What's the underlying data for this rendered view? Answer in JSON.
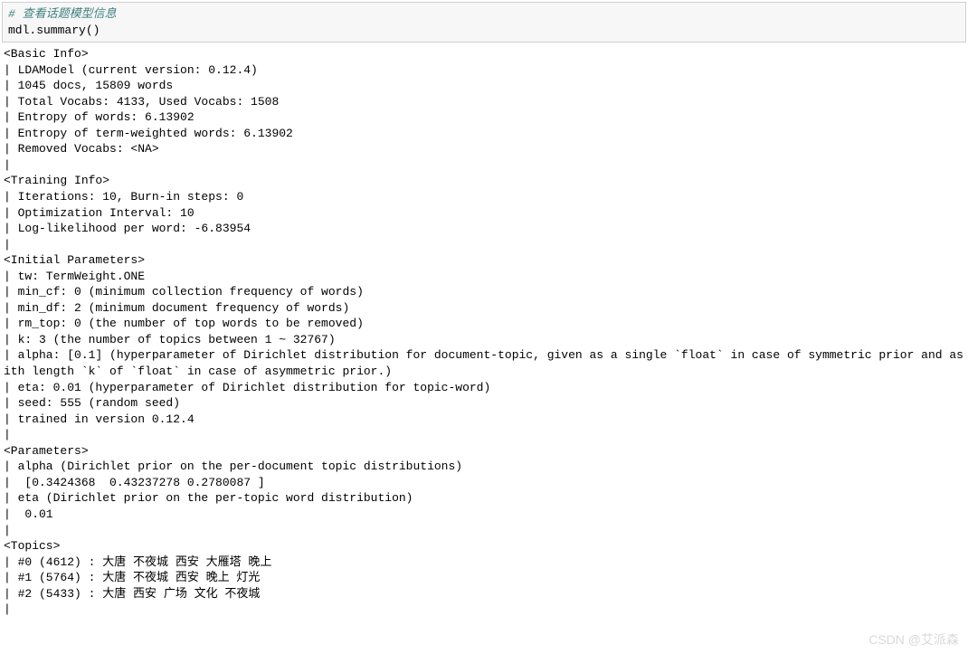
{
  "cell": {
    "comment": "# 查看话题模型信息",
    "code": "mdl.summary()"
  },
  "output_lines": [
    "<Basic Info>",
    "| LDAModel (current version: 0.12.4)",
    "| 1045 docs, 15809 words",
    "| Total Vocabs: 4133, Used Vocabs: 1508",
    "| Entropy of words: 6.13902",
    "| Entropy of term-weighted words: 6.13902",
    "| Removed Vocabs: <NA>",
    "|",
    "<Training Info>",
    "| Iterations: 10, Burn-in steps: 0",
    "| Optimization Interval: 10",
    "| Log-likelihood per word: -6.83954",
    "|",
    "<Initial Parameters>",
    "| tw: TermWeight.ONE",
    "| min_cf: 0 (minimum collection frequency of words)",
    "| min_df: 2 (minimum document frequency of words)",
    "| rm_top: 0 (the number of top words to be removed)",
    "| k: 3 (the number of topics between 1 ~ 32767)",
    "| alpha: [0.1] (hyperparameter of Dirichlet distribution for document-topic, given as a single `float` in case of symmetric prior and as a list with length `k` of `float` in case of asymmetric prior.)",
    "| eta: 0.01 (hyperparameter of Dirichlet distribution for topic-word)",
    "| seed: 555 (random seed)",
    "| trained in version 0.12.4",
    "|",
    "<Parameters>",
    "| alpha (Dirichlet prior on the per-document topic distributions)",
    "|  [0.3424368  0.43237278 0.2780087 ]",
    "| eta (Dirichlet prior on the per-topic word distribution)",
    "|  0.01",
    "|",
    "<Topics>",
    "| #0 (4612) : 大唐 不夜城 西安 大雁塔 晚上",
    "| #1 (5764) : 大唐 不夜城 西安 晚上 灯光",
    "| #2 (5433) : 大唐 西安 广场 文化 不夜城",
    "|"
  ],
  "watermark": "CSDN @艾派森"
}
